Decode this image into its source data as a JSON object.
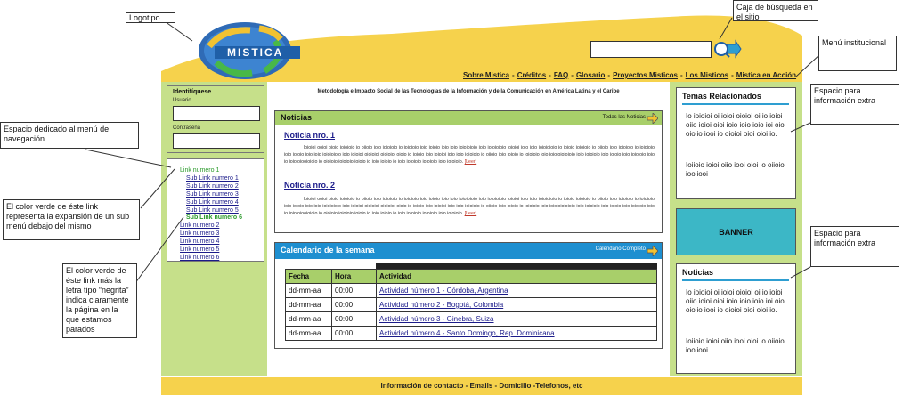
{
  "logo": {
    "text": "MISTICA"
  },
  "header": {
    "menu": [
      "Sobre Mistica",
      "Créditos",
      "FAQ",
      "Glosario",
      "Proyectos Misticos",
      "Los Misticos",
      "Mistica en Acción"
    ]
  },
  "search": {
    "placeholder": ""
  },
  "login": {
    "title": "Identifíquese",
    "user_label": "Usuario",
    "password_label": "Contraseña"
  },
  "nav": {
    "items": [
      {
        "label": "Link numero 1",
        "state": "expanded"
      },
      {
        "label": "Sub Link numero 1",
        "state": "sub"
      },
      {
        "label": "Sub Link numero 2",
        "state": "sub"
      },
      {
        "label": "Sub Link numero 3",
        "state": "sub"
      },
      {
        "label": "Sub Link numero 4",
        "state": "sub"
      },
      {
        "label": "Sub Link numero 5",
        "state": "sub"
      },
      {
        "label": "Sub Link numero 6",
        "state": "current"
      },
      {
        "label": "Link numero 2",
        "state": "normal"
      },
      {
        "label": "Link numero 3",
        "state": "normal"
      },
      {
        "label": "Link numero 4",
        "state": "normal"
      },
      {
        "label": "Link numero 5",
        "state": "normal"
      },
      {
        "label": "Link numero 6",
        "state": "normal"
      }
    ]
  },
  "center": {
    "title": "Metodología e Impacto Social de las Tecnologías de la Información y de la Comunicación en América Latina y el Caribe"
  },
  "news": {
    "title": "Noticias",
    "all_link": "Todas las Noticias",
    "items": [
      {
        "title": "Noticia nro. 1",
        "body": "loioioi ooioi oioio ioioioio io oiioio ioio ioioioio io ioioioio ioio ioioio ioio ioio ioioioioio ioio ioioioioio ioioioi ioio ioio ioioioioio io ioioio ioioioio io oiioio ioio ioioioio io ioioioio ioio ioioio ioio ioio ioioioioio ioio ioioioi oioioioi oioioioi oioio io ioioio ioio ioioioi ioio ioio ioioioio io oiioio ioio ioioio io ioioioio ioio ioioioioioioio ioio ioioioio ioio ioioio ioio ioioioio ioio io ioioioiooioioio io oioioio ioioioio ioioio io ioio ioioio io ioio ioioioio ioioioio ioio ioioioio.",
        "more": "[Leer]"
      },
      {
        "title": "Noticia nro. 2",
        "body": "loioioi ooioi oioio ioioioio io oiioio ioio ioioioio io ioioioio ioio ioioio ioio ioio ioioioioio ioio ioioioioio ioioioi ioio ioio ioioioioio io ioioio ioioioio io oiioio ioio ioioioio io ioioioio ioio ioioio ioio ioio ioioioioio ioio ioioioi oioioioi oioioioi oioio io ioioio ioio ioioioi ioio ioio ioioioio io oiioio ioio ioioio io ioioioio ioio ioioioioioioio ioio ioioioio ioio ioioio ioio ioioioio ioio io ioioioiooioioio io oioioio ioioioio ioioio io ioio ioioio io ioio ioioioio ioioioio ioio ioioioio.",
        "more": "[Leer]"
      }
    ]
  },
  "calendar": {
    "title": "Calendario de la semana",
    "all_link": "Calendario Completo",
    "headers": [
      "Fecha",
      "Hora",
      "Actividad"
    ],
    "rows": [
      [
        "dd-mm-aa",
        "00:00",
        "Actividad número 1 - Córdoba,  Argentina"
      ],
      [
        "dd-mm-aa",
        "00:00",
        "Actividad número 2 - Bogotá, Colombia"
      ],
      [
        "dd-mm-aa",
        "00:00",
        "Actividad número 3 - Ginebra, Suiza"
      ],
      [
        "dd-mm-aa",
        "00:00",
        "Actividad número 4 - Santo Domingo, Rep. Dominicana"
      ]
    ]
  },
  "right": {
    "related": {
      "title": "Temas Relacionados",
      "para1": "Io ioioioi oi ioioi oioioi oi io ioioi oiio ioioi oioi ioio ioio ioio ioi oioi oioiio iooi io oioioi oioi oioi io.",
      "para2": "Ioiioio ioioi oiio iooi oioi io oiioio iooiiooi"
    },
    "banner": "BANNER",
    "news": {
      "title": "Noticias",
      "para1": "Io ioioioi oi ioioi oioioi oi io ioioi oiio ioioi oioi ioio ioio ioio ioi oioi oioiio iooi io oioioi oioi oioi io.",
      "para2": "Ioiioio ioioi oiio iooi oioi io oiioio iooiiooi"
    }
  },
  "footer": {
    "text": "Información de contacto - Emails - Domicilio -Telefonos, etc"
  },
  "annotations": {
    "logo": "Logotipo",
    "search": "Caja de búsqueda en el sitio",
    "inst_menu": "Menú institucional",
    "nav_space": "Espacio dedicado al menú de navegación",
    "expanded_note": "El color verde de éste link representa la expansión de un sub menú debajo del mismo",
    "current_note": "El color verde de éste link más la letra tipo “negrita” indica claramente la página en la que estamos parados",
    "extra1": "Espacio para información extra",
    "extra2": "Espacio para información extra"
  },
  "colors": {
    "yellow": "#f6d24c",
    "green": "#c6e08a",
    "header_green": "#a8cf6a",
    "calendar_blue": "#1e8fd0",
    "banner": "#3cb7c6",
    "link": "#1b1b8a",
    "nav_green": "#2a9a2a"
  }
}
